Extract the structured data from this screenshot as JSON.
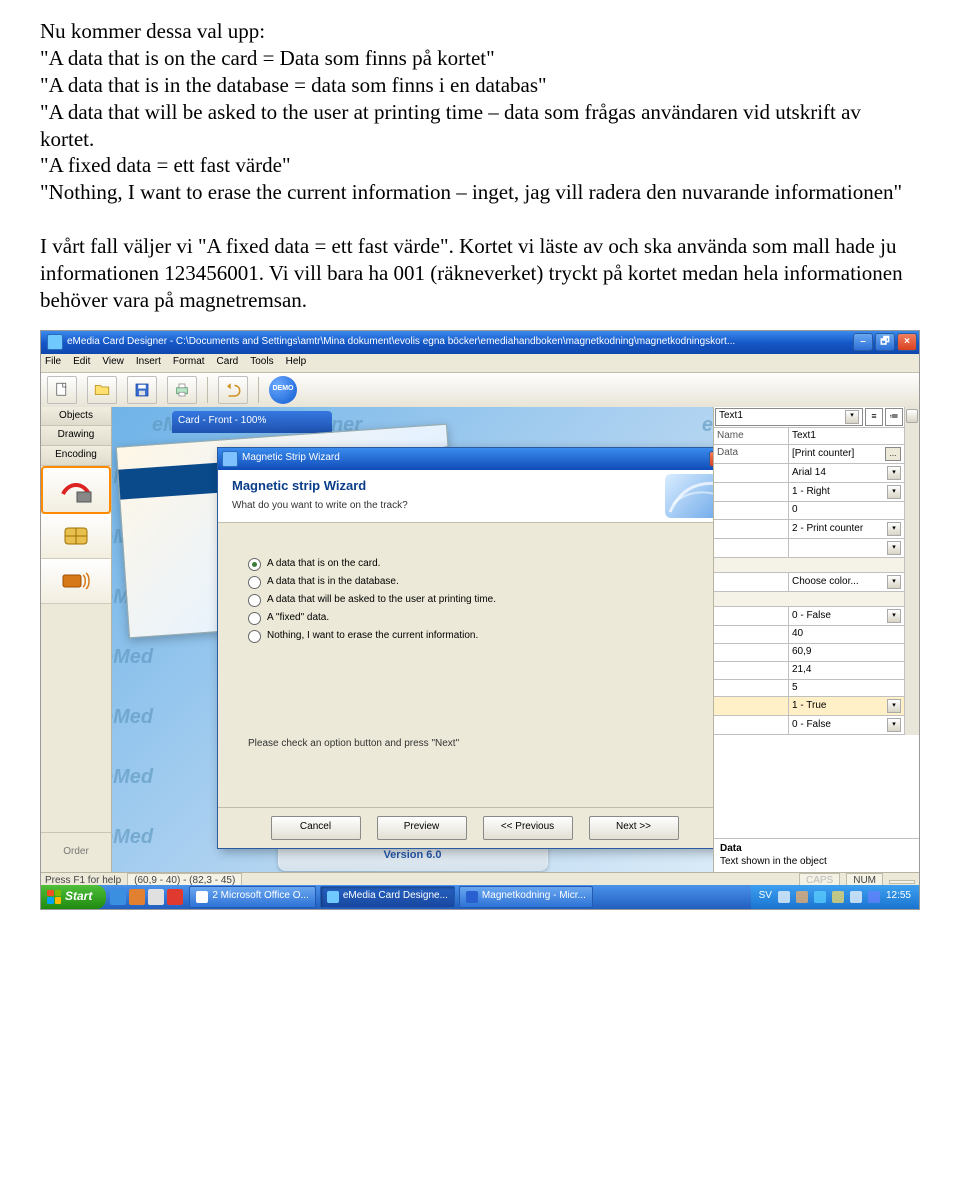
{
  "doc": {
    "intro": "Nu kommer dessa val upp:",
    "opt1": "\"A data that is on the card = Data som finns på kortet\"",
    "opt2": "\"A data that is in the database = data som finns i en databas\"",
    "opt3": "\"A data that will be asked to the user at printing time – data som frågas användaren vid utskrift av kortet.",
    "opt4": "\"A fixed data = ett fast värde\"",
    "opt5": "\"Nothing, I want to erase the current information – inget, jag vill radera den nuvarande informationen\"",
    "para2": "I vårt fall väljer vi \"A fixed data = ett fast värde\". Kortet vi läste av och ska använda som mall hade ju informationen 123456001. Vi vill bara ha 001 (räkneverket) tryckt på kortet medan hela informationen behöver vara på magnetremsan."
  },
  "app": {
    "title": "eMedia Card Designer - C:\\Documents and Settings\\amtr\\Mina dokument\\evolis egna böcker\\emediahandboken\\magnetkodning\\magnetkodningskort...",
    "menu": [
      "File",
      "Edit",
      "View",
      "Insert",
      "Format",
      "Card",
      "Tools",
      "Help"
    ],
    "demo": "DEMO",
    "tabs": {
      "objects": "Objects",
      "drawing": "Drawing",
      "encoding": "Encoding",
      "order": "Order"
    },
    "cardwin_title": "Card - Front - 100%",
    "brand1": "eMedia Card Designer",
    "brand2": "Version 6.0",
    "watermark": "eMedia Card Designer",
    "wm_short": "eMed"
  },
  "wizard": {
    "title": "Magnetic Strip Wizard",
    "heading": "Magnetic strip Wizard",
    "question": "What do you want to write on the track?",
    "options": [
      "A data that is on the card.",
      "A data that is in the database.",
      "A data that will be asked to the user at printing time.",
      "A \"fixed\" data.",
      "Nothing, I want to erase the current information."
    ],
    "selected": 0,
    "note": "Please check an option button and press \"Next\"",
    "buttons": {
      "cancel": "Cancel",
      "preview": "Preview",
      "prev": "<< Previous",
      "next": "Next >>"
    }
  },
  "props": {
    "selector": "Text1",
    "rows": [
      {
        "k": "Name",
        "v": "Text1",
        "dd": false
      },
      {
        "k": "Data",
        "v": "[Print counter]",
        "dd": false,
        "el": true
      },
      {
        "k": "",
        "v": "Arial 14",
        "dd": true
      },
      {
        "k": "",
        "v": "1 - Right",
        "dd": true
      },
      {
        "k": "",
        "v": "0",
        "dd": false
      },
      {
        "k": "",
        "v": "2 - Print counter",
        "dd": true
      },
      {
        "k": "",
        "v": "",
        "dd": true
      },
      {
        "k": "",
        "v": "",
        "dd": false,
        "gap": true
      },
      {
        "k": "",
        "v": "Choose color...",
        "dd": true
      },
      {
        "k": "",
        "v": "",
        "dd": false,
        "gap": true
      },
      {
        "k": "",
        "v": "0 - False",
        "dd": true
      },
      {
        "k": "",
        "v": "40",
        "dd": false
      },
      {
        "k": "",
        "v": "60,9",
        "dd": false
      },
      {
        "k": "",
        "v": "21,4",
        "dd": false
      },
      {
        "k": "",
        "v": "5",
        "dd": false
      },
      {
        "k": "",
        "v": "1 - True",
        "dd": true,
        "hl": true
      },
      {
        "k": "",
        "v": "0 - False",
        "dd": true
      }
    ],
    "footer_title": "Data",
    "footer_text": "Text shown in the object"
  },
  "status": {
    "help": "Press F1 for help",
    "coords": "(60,9 - 40) - (82,3 - 45)",
    "caps": "CAPS",
    "num": "NUM"
  },
  "taskbar": {
    "start": "Start",
    "tasks": [
      {
        "label": "2 Microsoft Office O..."
      },
      {
        "label": "eMedia Card Designe...",
        "active": true
      },
      {
        "label": "Magnetkodning - Micr..."
      }
    ],
    "lang": "SV",
    "time": "12:55"
  }
}
